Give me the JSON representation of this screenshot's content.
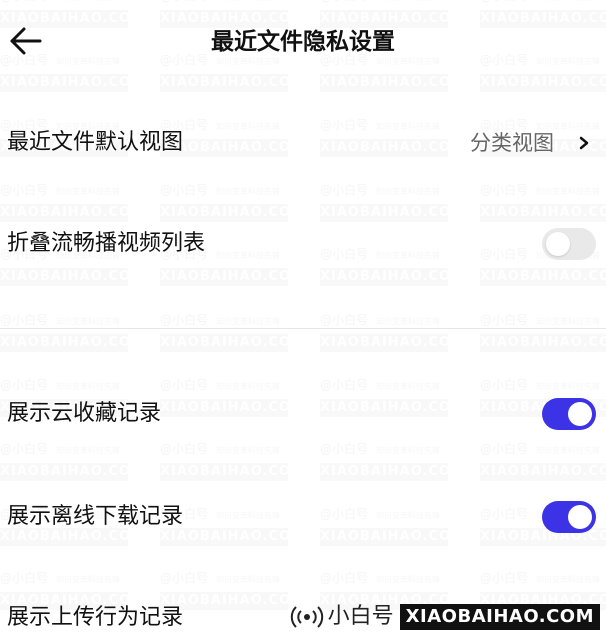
{
  "header": {
    "title": "最近文件隐私设置",
    "back_icon": "arrow-left-icon"
  },
  "settings": [
    {
      "label": "最近文件默认视图",
      "value": "分类视图",
      "type": "link"
    },
    {
      "label": "折叠流畅播视频列表",
      "type": "toggle",
      "on": false
    },
    {
      "label": "展示云收藏记录",
      "type": "toggle",
      "on": true
    },
    {
      "label": "展示离线下载记录",
      "type": "toggle",
      "on": true
    },
    {
      "label": "展示上传行为记录",
      "type": "toggle"
    }
  ],
  "watermark": {
    "line1": "@小白号",
    "line1_small": "知识变革科技先锋",
    "line2": "XIAOBAIHAO.COM"
  },
  "brand": {
    "icon": "radio-signal-icon",
    "cn": "小白号",
    "en": "XIAOBAIHAO.COM"
  },
  "colors": {
    "toggle_on": "#3d33e6",
    "toggle_off": "#e9e9e9"
  }
}
